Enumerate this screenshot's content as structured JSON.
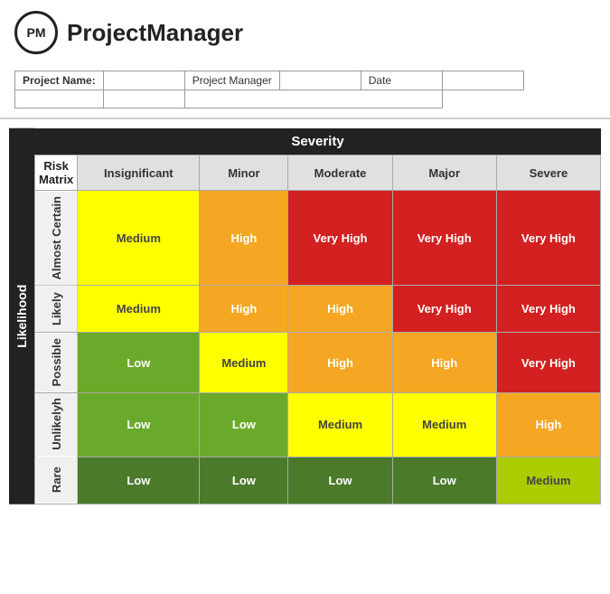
{
  "header": {
    "logo_text": "PM",
    "app_name": "ProjectManager"
  },
  "project_info": {
    "fields": [
      {
        "label": "Project Name:",
        "value": ""
      },
      {
        "label": "Project Manager",
        "value": ""
      },
      {
        "label": "Date",
        "value": ""
      }
    ]
  },
  "matrix": {
    "title": "Risk Matrix",
    "severity_label": "Severity",
    "likelihood_label": "Likelihood",
    "severity_cols": [
      "Insignificant",
      "Minor",
      "Moderate",
      "Major",
      "Severe"
    ],
    "rows": [
      {
        "label": "Almost Certain",
        "cells": [
          {
            "text": "Medium",
            "color": "yellow"
          },
          {
            "text": "High",
            "color": "orange"
          },
          {
            "text": "Very High",
            "color": "red"
          },
          {
            "text": "Very High",
            "color": "red"
          },
          {
            "text": "Very High",
            "color": "red"
          }
        ]
      },
      {
        "label": "Likely",
        "cells": [
          {
            "text": "Medium",
            "color": "yellow"
          },
          {
            "text": "High",
            "color": "orange"
          },
          {
            "text": "High",
            "color": "orange"
          },
          {
            "text": "Very High",
            "color": "red"
          },
          {
            "text": "Very High",
            "color": "red"
          }
        ]
      },
      {
        "label": "Possible",
        "cells": [
          {
            "text": "Low",
            "color": "green-mid"
          },
          {
            "text": "Medium",
            "color": "yellow"
          },
          {
            "text": "High",
            "color": "orange"
          },
          {
            "text": "High",
            "color": "orange"
          },
          {
            "text": "Very High",
            "color": "red"
          }
        ]
      },
      {
        "label": "Unlikelyh",
        "cells": [
          {
            "text": "Low",
            "color": "green-mid"
          },
          {
            "text": "Low",
            "color": "green-mid"
          },
          {
            "text": "Medium",
            "color": "yellow"
          },
          {
            "text": "Medium",
            "color": "yellow"
          },
          {
            "text": "High",
            "color": "orange"
          }
        ]
      },
      {
        "label": "Rare",
        "cells": [
          {
            "text": "Low",
            "color": "green-dark"
          },
          {
            "text": "Low",
            "color": "green-dark"
          },
          {
            "text": "Low",
            "color": "green-dark"
          },
          {
            "text": "Low",
            "color": "green-dark"
          },
          {
            "text": "Medium",
            "color": "yellow-green"
          }
        ]
      }
    ]
  }
}
